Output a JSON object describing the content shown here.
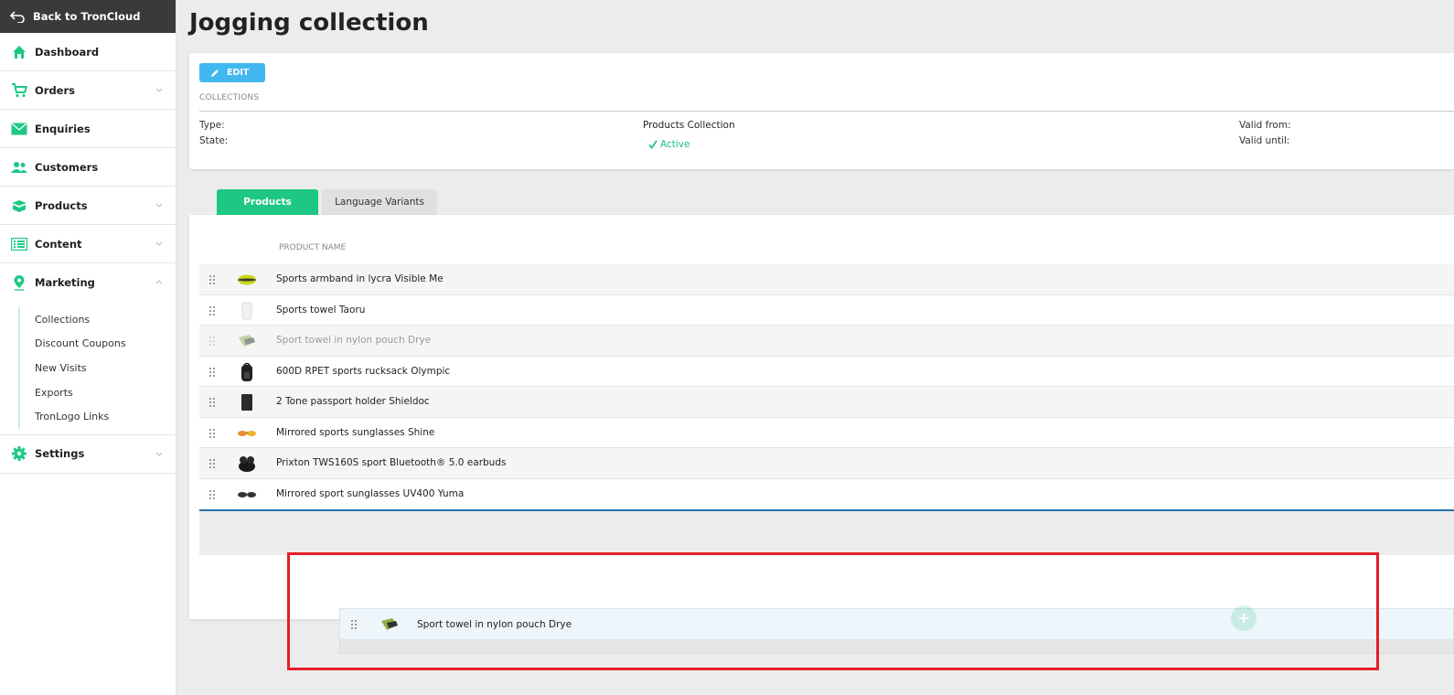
{
  "sidebar": {
    "back_label": "Back to TronCloud",
    "items": [
      {
        "label": "Dashboard",
        "icon": "home-icon"
      },
      {
        "label": "Orders",
        "icon": "cart-icon"
      },
      {
        "label": "Enquiries",
        "icon": "mail-icon"
      },
      {
        "label": "Customers",
        "icon": "users-icon"
      },
      {
        "label": "Products",
        "icon": "box-icon"
      },
      {
        "label": "Content",
        "icon": "list-icon"
      },
      {
        "label": "Marketing",
        "icon": "pin-icon"
      },
      {
        "label": "Settings",
        "icon": "gear-icon"
      }
    ],
    "marketing_sub": [
      "Collections",
      "Discount Coupons",
      "New Visits",
      "Exports",
      "TronLogo Links"
    ]
  },
  "page": {
    "title": "Jogging collection",
    "edit_label": "EDIT",
    "section_label": "COLLECTIONS",
    "type_label": "Type:",
    "type_value": "Products Collection",
    "state_label": "State:",
    "state_value": "Active",
    "valid_from_label": "Valid from:",
    "valid_until_label": "Valid until:"
  },
  "tabs": {
    "products": "Products",
    "language_variants": "Language Variants"
  },
  "table": {
    "column_product_name": "PRODUCT NAME",
    "rows": [
      {
        "name": "Sports armband in lycra Visible Me",
        "thumb": "armband-thumb"
      },
      {
        "name": "Sports towel Taoru",
        "thumb": "towel-thumb"
      },
      {
        "name": "Sport towel in nylon pouch Drye",
        "thumb": "pouch-thumb"
      },
      {
        "name": "600D RPET sports rucksack Olympic",
        "thumb": "rucksack-thumb"
      },
      {
        "name": "2 Tone passport holder Shieldoc",
        "thumb": "passport-thumb"
      },
      {
        "name": "Mirrored sports sunglasses Shine",
        "thumb": "sunglasses-thumb"
      },
      {
        "name": "Prixton TWS160S sport Bluetooth® 5.0 earbuds",
        "thumb": "earbuds-thumb"
      },
      {
        "name": "Mirrored sport sunglasses UV400 Yuma",
        "thumb": "sunglasses-thumb"
      }
    ]
  },
  "dragged": {
    "name": "Sport towel in nylon pouch Drye"
  },
  "colors": {
    "accent": "#1ec884",
    "edit": "#42b8f1",
    "highlight": "#e41e26",
    "sidebar_dark": "#3a3a3a"
  }
}
